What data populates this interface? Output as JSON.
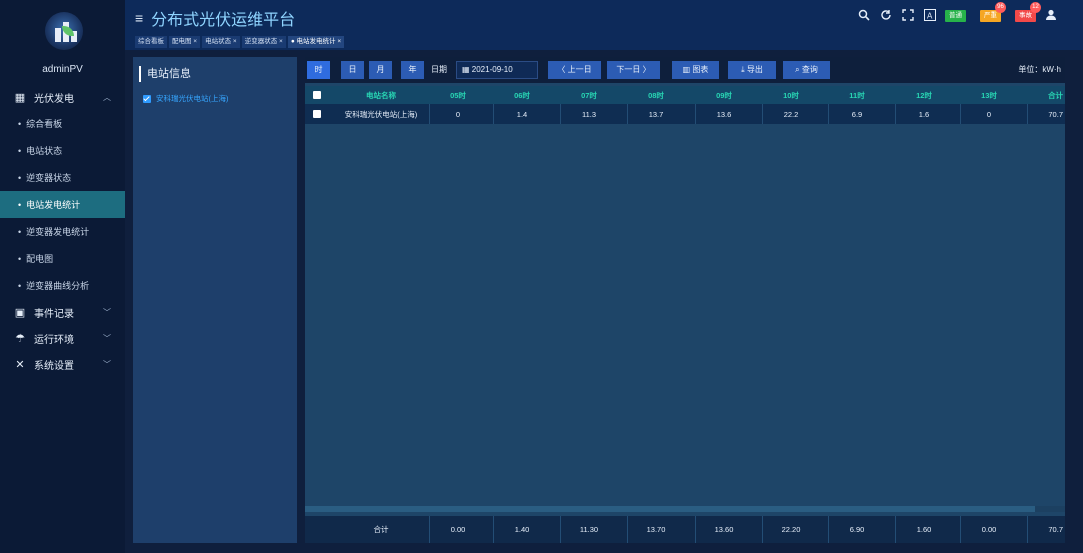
{
  "app": {
    "title": "分布式光伏运维平台",
    "user": "adminPV"
  },
  "header": {
    "tabs": [
      {
        "label": "综合看板"
      },
      {
        "label": "配电图 ×"
      },
      {
        "label": "电站状态 ×"
      },
      {
        "label": "逆变器状态 ×"
      },
      {
        "label": "● 电站发电统计 ×"
      }
    ],
    "tools": [
      {
        "icon": "search-icon",
        "glyph": "🔍"
      },
      {
        "icon": "refresh-icon",
        "glyph": "⟳"
      },
      {
        "icon": "fullscreen-icon",
        "glyph": "⛶"
      },
      {
        "icon": "font-size-icon",
        "glyph": "A"
      }
    ],
    "alerts": [
      {
        "label": "普通",
        "color": "#27b24a",
        "count": ""
      },
      {
        "label": "严重",
        "color": "#f5a623",
        "count": "96"
      },
      {
        "label": "事故",
        "color": "#f24949",
        "count": "12"
      }
    ]
  },
  "sidebar": {
    "groups": [
      {
        "label": "光伏发电",
        "icon": "grid-icon",
        "expanded": true,
        "items": [
          {
            "label": "综合看板",
            "active": false
          },
          {
            "label": "电站状态",
            "active": false
          },
          {
            "label": "逆变器状态",
            "active": false
          },
          {
            "label": "电站发电统计",
            "active": true
          },
          {
            "label": "逆变器发电统计",
            "active": false
          },
          {
            "label": "配电图",
            "active": false
          },
          {
            "label": "逆变器曲线分析",
            "active": false
          }
        ]
      },
      {
        "label": "事件记录",
        "icon": "calendar-icon",
        "expanded": false
      },
      {
        "label": "运行环境",
        "icon": "weather-icon",
        "expanded": false
      },
      {
        "label": "系统设置",
        "icon": "tools-icon",
        "expanded": false
      }
    ]
  },
  "station_panel": {
    "title": "电站信息",
    "station": "安科瑞光伏电站(上海)",
    "checked": true
  },
  "toolbar": {
    "periods": [
      "时",
      "日",
      "月",
      "年"
    ],
    "date_label": "日期",
    "date_value": "2021-09-10",
    "prev_label": "〈 上一日",
    "next_label": "下一日 〉",
    "chart_label": "图表",
    "export_label": "导出",
    "query_label": "查询",
    "unit": "单位：kW·h"
  },
  "table": {
    "headers": [
      "电站名称",
      "05时",
      "06时",
      "07时",
      "08时",
      "09时",
      "10时",
      "11时",
      "12时",
      "13时",
      "合计"
    ],
    "rows": [
      [
        "安科瑞光伏电站(上海)",
        "0",
        "1.4",
        "11.3",
        "13.7",
        "13.6",
        "22.2",
        "6.9",
        "1.6",
        "0",
        "70.7"
      ]
    ],
    "footer": [
      "合计",
      "0.00",
      "1.40",
      "11.30",
      "13.70",
      "13.60",
      "22.20",
      "6.90",
      "1.60",
      "0.00",
      "70.7"
    ]
  }
}
